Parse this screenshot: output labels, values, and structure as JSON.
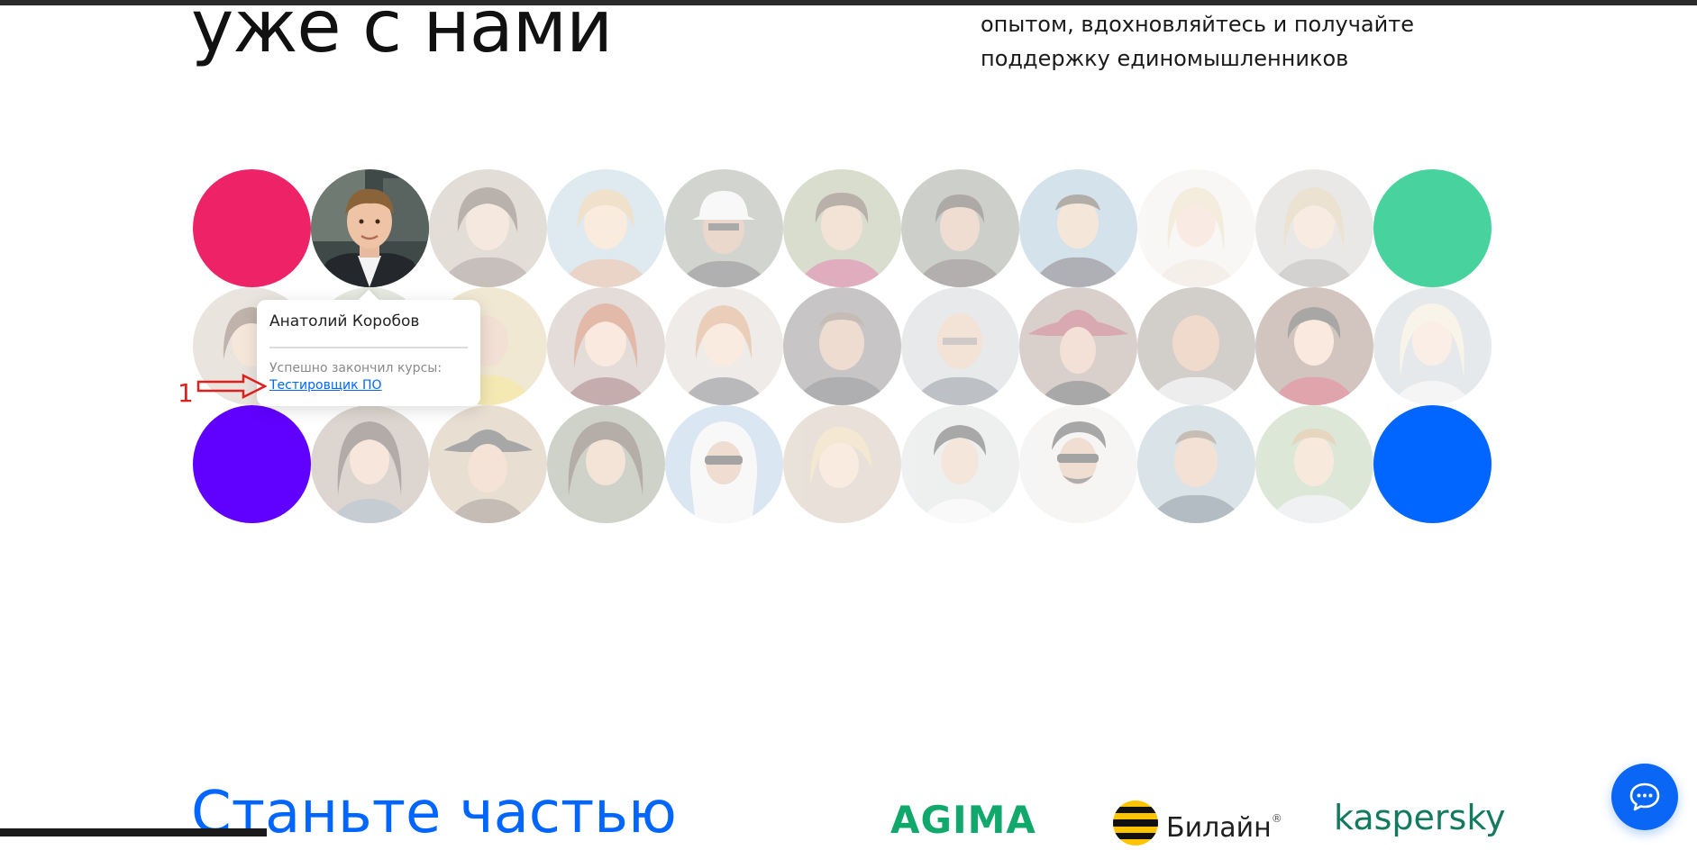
{
  "hero": {
    "headline": "уже с нами",
    "subtext_line1": "опытом, вдохновляйтесь и получайте",
    "subtext_line2": "поддержку единомышленников"
  },
  "avatars": {
    "accent_colors": {
      "pink": "#ee2266",
      "green": "#48d29e",
      "purple": "#6000ff",
      "blue": "#0066ff"
    }
  },
  "tooltip": {
    "name": "Анатолий Коробов",
    "label": "Успешно закончил курсы:",
    "course_link": "Тестировщик ПО"
  },
  "annotation": {
    "number": "1",
    "color": "#e0201e"
  },
  "cta": {
    "heading": "Станьте частью"
  },
  "partners": {
    "agima": "AGIMA",
    "beeline": "Билайн",
    "beeline_mark": "®",
    "kaspersky": "kaspersky"
  },
  "chat": {
    "icon": "chat-bubble-icon"
  }
}
